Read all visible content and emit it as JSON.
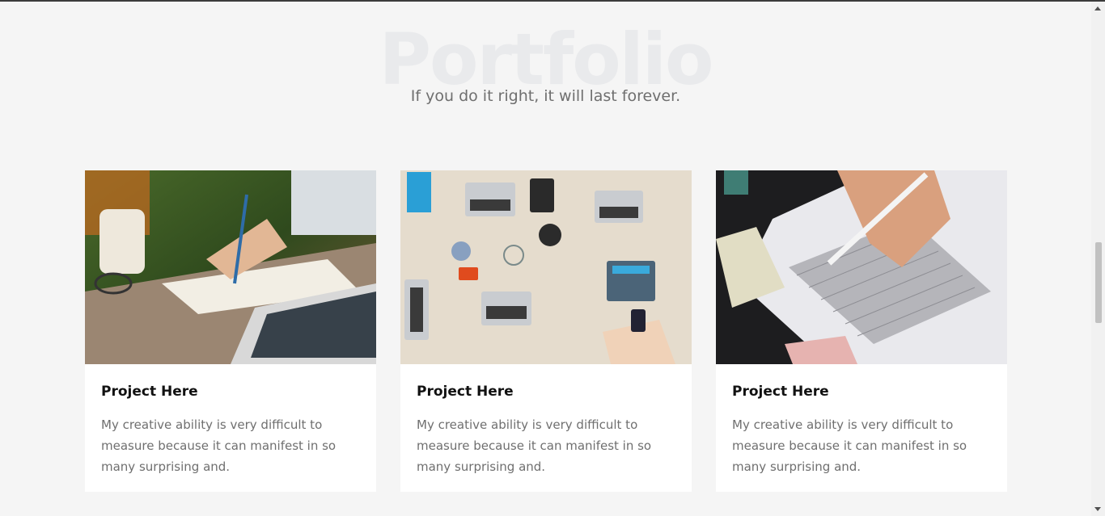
{
  "section": {
    "title": "Portfolio",
    "subtitle": "If you do it right, it will last forever."
  },
  "projects": [
    {
      "title": "Project Here",
      "description": "My creative ability is very difficult to measure because it can manifest in so many surprising and.",
      "image": "notebook-writing-photo"
    },
    {
      "title": "Project Here",
      "description": "My creative ability is very difficult to measure because it can manifest in so many surprising and.",
      "image": "team-desk-laptops-photo"
    },
    {
      "title": "Project Here",
      "description": "My creative ability is very difficult to measure because it can manifest in so many surprising and.",
      "image": "exam-answer-sheet-photo"
    }
  ],
  "scrollbar": {
    "up_icon": "arrow-up-icon",
    "down_icon": "arrow-down-icon",
    "position": 0.47
  }
}
